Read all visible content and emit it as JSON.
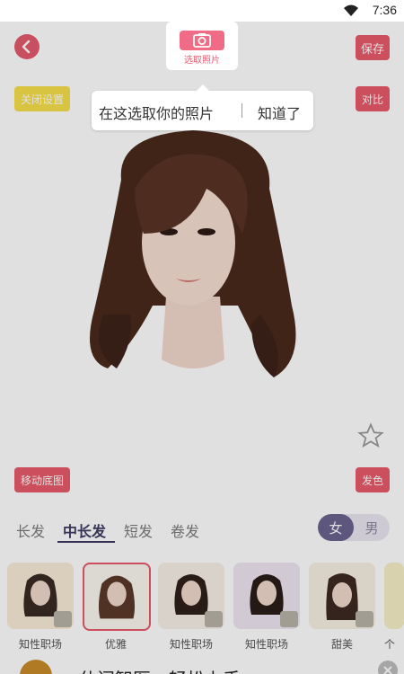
{
  "status": {
    "time": "7:36"
  },
  "topbar": {
    "upload_label": "选取照片",
    "save_label": "保存"
  },
  "canvas": {
    "left_chip": "关闭设置",
    "right_chip": "对比",
    "move_chip": "移动底图",
    "color_chip": "发色"
  },
  "tabs": [
    "长发",
    "中长发",
    "短发",
    "卷发"
  ],
  "gender": {
    "female": "女",
    "male": "男"
  },
  "styles": [
    {
      "label": "知性职场"
    },
    {
      "label": "优雅"
    },
    {
      "label": "知性职场"
    },
    {
      "label": "知性职场"
    },
    {
      "label": "甜美"
    },
    {
      "label": "个"
    }
  ],
  "tooltip": {
    "text": "在这选取你的照片",
    "ok": "知道了"
  },
  "ad": {
    "text": "仕问智医，轻松上手"
  },
  "colors": {
    "accent": "#e85a6a",
    "tab_active": "#3e3b62"
  }
}
